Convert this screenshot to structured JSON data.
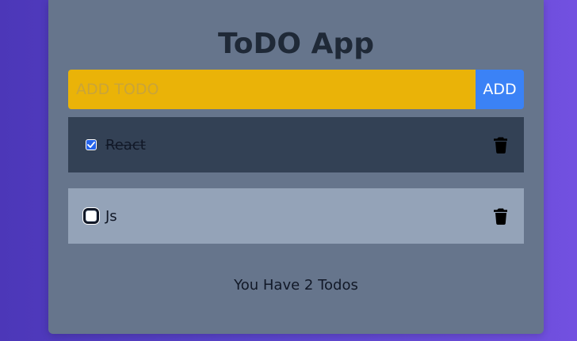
{
  "app": {
    "title": "ToDO App"
  },
  "form": {
    "placeholder": "ADD TODO",
    "add_label": "ADD"
  },
  "todos": [
    {
      "label": "React",
      "checked": true
    },
    {
      "label": "Js",
      "checked": false
    }
  ],
  "footer": {
    "count_text": "You Have 2 Todos"
  },
  "colors": {
    "background_start": "#4c37b8",
    "background_end": "#7250e0",
    "card": "#66758c",
    "input": "#eab308",
    "add_button": "#3b82f6",
    "done_item": "#334155",
    "pending_item": "#94a3b8"
  },
  "icons": {
    "delete": "trash-icon"
  }
}
